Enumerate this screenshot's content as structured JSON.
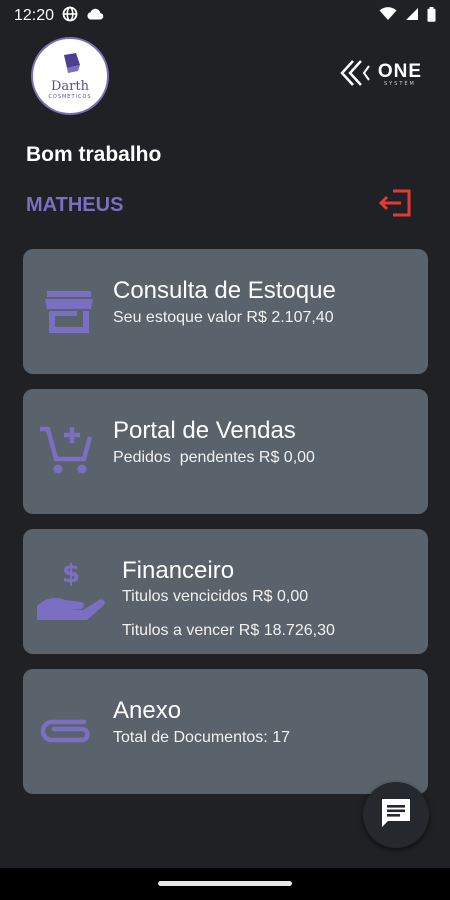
{
  "status_bar": {
    "time": "12:20"
  },
  "header": {
    "logo_title": "Darth",
    "logo_subtitle": "COSMETICOS",
    "brand_name": "ONE",
    "brand_sub": "SYSTEM"
  },
  "greeting": "Bom trabalho",
  "user": {
    "name": "MATHEUS"
  },
  "colors": {
    "background": "#1f2124",
    "card": "#5a636b",
    "accent": "#7a6fc2",
    "logout": "#e53935"
  },
  "cards": [
    {
      "icon": "store-icon",
      "title": "Consulta de Estoque",
      "lines": [
        "Seu estoque valor R$ 2.107,40"
      ]
    },
    {
      "icon": "cart-add-icon",
      "title": "Portal de Vendas",
      "lines": [
        "Pedidos  pendentes R$ 0,00"
      ]
    },
    {
      "icon": "hand-money-icon",
      "title": "Financeiro",
      "lines": [
        "Titulos vencicidos R$ 0,00",
        "Titulos a vencer R$ 18.726,30"
      ]
    },
    {
      "icon": "paperclip-icon",
      "title": "Anexo",
      "lines": [
        "Total de Documentos: 17"
      ]
    }
  ]
}
